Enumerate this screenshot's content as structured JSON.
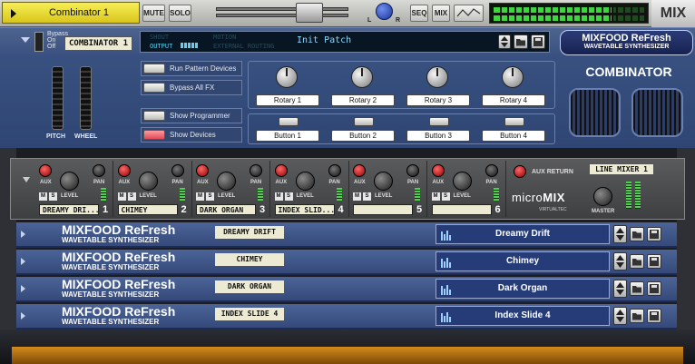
{
  "top_strip": {
    "device_name": "Combinator 1",
    "mute_label": "MUTE",
    "solo_label": "SOLO",
    "pan_left": "L",
    "pan_right": "R",
    "seq_label": "SEQ",
    "mix_label": "MIX",
    "mix_tag": "MIX"
  },
  "combinator": {
    "bypass_labels": [
      "Bypass",
      "On",
      "Off"
    ],
    "device_label": "COMBINATOR 1",
    "routing_labels": [
      "SHOUT",
      "OUTPUT",
      "MOTION",
      "EXTERNAL ROUTING"
    ],
    "patch_name": "Init Patch",
    "brand_title": "MIXFOOD ReFresh",
    "brand_subtitle": "WAVETABLE SYNTHESIZER",
    "title": "COMBINATOR",
    "pitch_label": "PITCH",
    "wheel_label": "WHEEL",
    "options": [
      {
        "label": "Run Pattern Devices",
        "on": false
      },
      {
        "label": "Bypass All FX",
        "on": false
      },
      {
        "label": "Show Programmer",
        "on": false
      },
      {
        "label": "Show Devices",
        "on": true
      }
    ],
    "rotaries": [
      "Rotary 1",
      "Rotary 2",
      "Rotary 3",
      "Rotary 4"
    ],
    "buttons": [
      "Button 1",
      "Button 2",
      "Button 3",
      "Button 4"
    ]
  },
  "micromix": {
    "knob_labels": {
      "aux": "AUX",
      "pan": "PAN",
      "level": "LEVEL",
      "mute": "M",
      "solo": "S"
    },
    "channels": [
      {
        "label": "DREAMY DRI...",
        "num": "1"
      },
      {
        "label": "CHIMEY",
        "num": "2"
      },
      {
        "label": "DARK ORGAN",
        "num": "3"
      },
      {
        "label": "INDEX SLID...",
        "num": "4"
      },
      {
        "label": "",
        "num": "5"
      },
      {
        "label": "",
        "num": "6"
      }
    ],
    "aux_return_label": "AUX RETURN",
    "device_label": "LINE MIXER 1",
    "logo_a": "micro",
    "logo_b": "MIX",
    "logo_sub": "VIRTUALTEC",
    "master_label": "MASTER"
  },
  "devices": [
    {
      "brand": "MIXFOOD ReFresh",
      "subtitle": "WAVETABLE SYNTHESIZER",
      "tape": "DREAMY DRIFT",
      "patch": "Dreamy Drift"
    },
    {
      "brand": "MIXFOOD ReFresh",
      "subtitle": "WAVETABLE SYNTHESIZER",
      "tape": "CHIMEY",
      "patch": "Chimey"
    },
    {
      "brand": "MIXFOOD ReFresh",
      "subtitle": "WAVETABLE SYNTHESIZER",
      "tape": "DARK ORGAN",
      "patch": "Dark Organ"
    },
    {
      "brand": "MIXFOOD ReFresh",
      "subtitle": "WAVETABLE SYNTHESIZER",
      "tape": "INDEX SLIDE 4",
      "patch": "Index Slide 4"
    }
  ],
  "icons": {
    "patch_bars": "bars-icon",
    "folder": "folder-icon",
    "save": "save-disk-icon",
    "updown": "up-down-arrow-icon"
  }
}
